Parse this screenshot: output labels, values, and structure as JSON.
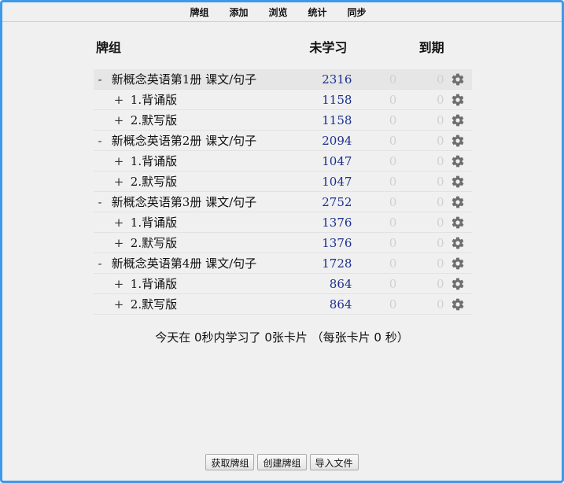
{
  "nav": {
    "decks": "牌组",
    "add": "添加",
    "browse": "浏览",
    "stats": "统计",
    "sync": "同步"
  },
  "table": {
    "col_deck": "牌组",
    "col_new": "未学习",
    "col_due": "到期"
  },
  "decks": [
    {
      "indent": 0,
      "toggle": "-",
      "name": "新概念英语第1册 课文/句子",
      "new": "2316",
      "due": "0",
      "learn": "0",
      "current": true
    },
    {
      "indent": 1,
      "toggle": "+",
      "name": "1.背诵版",
      "new": "1158",
      "due": "0",
      "learn": "0"
    },
    {
      "indent": 1,
      "toggle": "+",
      "name": "2.默写版",
      "new": "1158",
      "due": "0",
      "learn": "0"
    },
    {
      "indent": 0,
      "toggle": "-",
      "name": "新概念英语第2册 课文/句子",
      "new": "2094",
      "due": "0",
      "learn": "0"
    },
    {
      "indent": 1,
      "toggle": "+",
      "name": "1.背诵版",
      "new": "1047",
      "due": "0",
      "learn": "0"
    },
    {
      "indent": 1,
      "toggle": "+",
      "name": "2.默写版",
      "new": "1047",
      "due": "0",
      "learn": "0"
    },
    {
      "indent": 0,
      "toggle": "-",
      "name": "新概念英语第3册 课文/句子",
      "new": "2752",
      "due": "0",
      "learn": "0"
    },
    {
      "indent": 1,
      "toggle": "+",
      "name": "1.背诵版",
      "new": "1376",
      "due": "0",
      "learn": "0"
    },
    {
      "indent": 1,
      "toggle": "+",
      "name": "2.默写版",
      "new": "1376",
      "due": "0",
      "learn": "0"
    },
    {
      "indent": 0,
      "toggle": "-",
      "name": "新概念英语第4册 课文/句子",
      "new": "1728",
      "due": "0",
      "learn": "0"
    },
    {
      "indent": 1,
      "toggle": "+",
      "name": "1.背诵版",
      "new": "864",
      "due": "0",
      "learn": "0"
    },
    {
      "indent": 1,
      "toggle": "+",
      "name": "2.默写版",
      "new": "864",
      "due": "0",
      "learn": "0"
    }
  ],
  "summary": "今天在 0秒内学习了 0张卡片 （每张卡片 0 秒）",
  "buttons": {
    "get_shared": "获取牌组",
    "create_deck": "创建牌组",
    "import_file": "导入文件"
  },
  "colors": {
    "window_border": "#3d9ae8",
    "new_count": "#1b2f8e",
    "zero_count": "#d0d0d0",
    "background": "#f0f0f0"
  }
}
